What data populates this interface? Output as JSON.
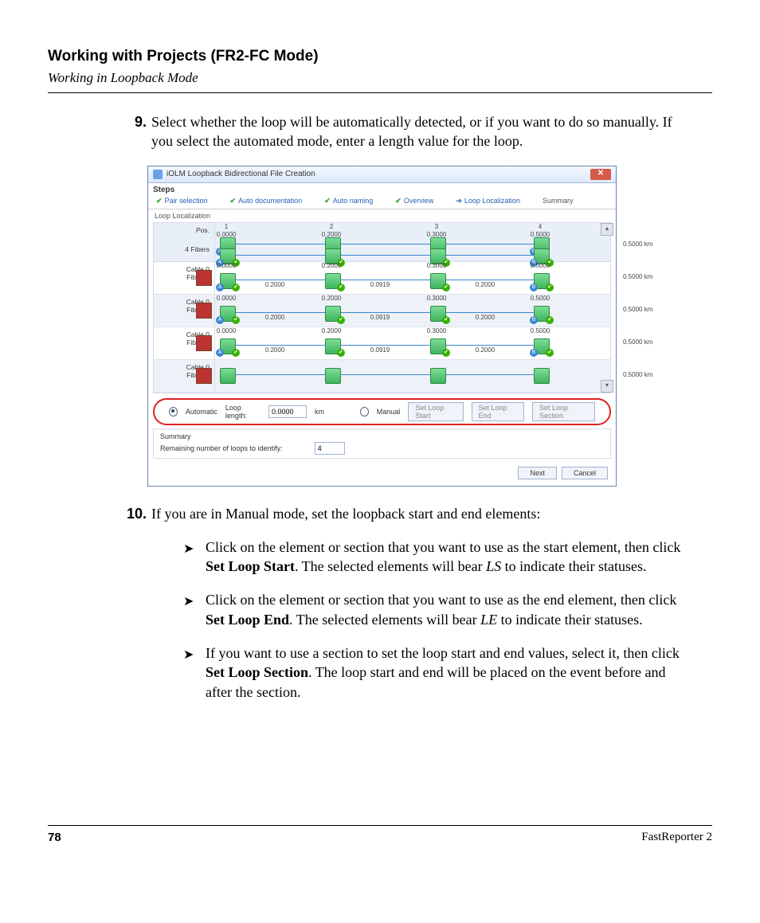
{
  "chapter_title": "Working with Projects (FR2-FC Mode)",
  "section_title": "Working in Loopback Mode",
  "step9": {
    "num": "9.",
    "text": "Select whether the loop will be automatically detected, or if you want to do so manually. If you select the automated mode, enter a length value for the loop."
  },
  "step10": {
    "num": "10.",
    "text": "If you are in Manual mode, set the loopback start and end elements:"
  },
  "bullet1": {
    "pre": "Click on the element or section that you want to use as the start element, then click ",
    "bold": "Set Loop Start",
    "post": ". The selected elements will bear ",
    "italic": "LS",
    "tail": " to indicate their statuses."
  },
  "bullet2": {
    "pre": "Click on the element or section that you want to use as the end element, then click ",
    "bold": "Set Loop End",
    "post": ". The selected elements will bear ",
    "italic": "LE",
    "tail": " to indicate their statuses."
  },
  "bullet3": {
    "pre": "If you want to use a section to set the loop start and end values, select it, then click ",
    "bold": "Set Loop Section",
    "post": ". The loop start and end will be placed on the event before and after the section."
  },
  "page_number": "78",
  "product_name": "FastReporter 2",
  "dlg": {
    "title": "iOLM Loopback Bidirectional File Creation",
    "steps_header": "Steps",
    "tabs": {
      "pair": "Pair selection",
      "auto_doc": "Auto documentation",
      "auto_name": "Auto naming",
      "overview": "Overview",
      "loop": "Loop Localization",
      "summary": "Summary"
    },
    "group_label": "Loop Localization",
    "header": {
      "pos": "Pos.",
      "fibers": "4 Fibers",
      "cols": [
        "1",
        "2",
        "3",
        "4"
      ],
      "colvals": [
        "0.0000",
        "0.2000",
        "0.3000",
        "0.5000"
      ],
      "total": "0.5000  km"
    },
    "rows": [
      {
        "a": "Cable 0",
        "b": "Fiber00",
        "top": [
          "0.0000",
          "0.2000",
          "0.3000",
          "0.5000"
        ],
        "mid": [
          "0.2000",
          "0.0919",
          "0.2000"
        ],
        "d": "0.5000  km"
      },
      {
        "a": "Cable 0",
        "b": "Fiber00",
        "top": [
          "0.0000",
          "0.2000",
          "0.3000",
          "0.5000"
        ],
        "mid": [
          "0.2000",
          "0.0919",
          "0.2000"
        ],
        "d": "0.5000  km"
      },
      {
        "a": "Cable 0",
        "b": "Fiber00",
        "top": [
          "0.0000",
          "0.2000",
          "0.3000",
          "0.5000"
        ],
        "mid": [
          "0.2000",
          "0.0919",
          "0.2000"
        ],
        "d": "0.5000  km"
      },
      {
        "a": "Cable 0",
        "b": "Fiber00",
        "top": [],
        "mid": [],
        "d": "0.5000  km"
      }
    ],
    "controls": {
      "automatic": "Automatic",
      "loop_length_label": "Loop length:",
      "loop_length_value": "0.0000",
      "unit": "km",
      "manual": "Manual",
      "set_start": "Set Loop Start",
      "set_end": "Set Loop End",
      "set_section": "Set Loop Section"
    },
    "summary": {
      "label": "Summary",
      "remaining": "Remaining number of loops to identify:",
      "value": "4"
    },
    "buttons": {
      "next": "Next",
      "cancel": "Cancel"
    }
  }
}
